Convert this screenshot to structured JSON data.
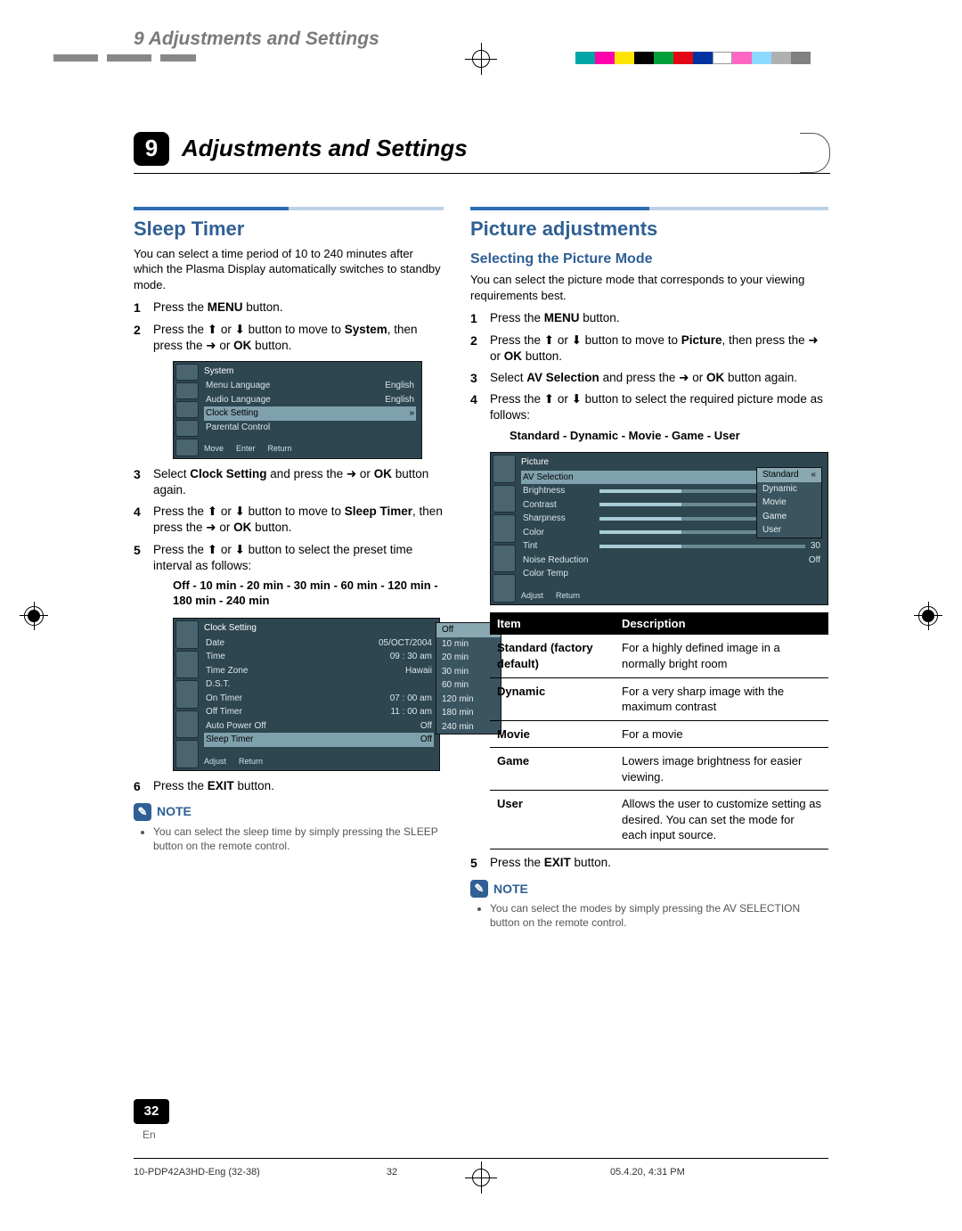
{
  "header": {
    "running": "9 Adjustments and Settings",
    "chapter_num": "9",
    "chapter_title": "Adjustments and Settings"
  },
  "colorbar": [
    "#00a6a6",
    "#ff00aa",
    "#ffe600",
    "#000000",
    "#00a03b",
    "#e30613",
    "#0033a0",
    "#ffffff",
    "#ff66c4",
    "#8cd9ff",
    "#b0b0b0",
    "#808080"
  ],
  "left": {
    "title": "Sleep Timer",
    "intro": "You can select a time period of 10 to 240 minutes after which the Plasma Display automatically switches to standby mode.",
    "steps": {
      "s1_a": "Press the ",
      "s1_b": "MENU",
      "s1_c": " button.",
      "s2_a": "Press the ",
      "s2_b": " or ",
      "s2_c": " button to move to ",
      "s2_d": "System",
      "s2_e": ", then press the ",
      "s2_f": " or ",
      "s2_g": "OK",
      "s2_h": " button.",
      "s3_a": "Select ",
      "s3_b": "Clock Setting",
      "s3_c": " and press the ",
      "s3_d": " or ",
      "s3_e": "OK",
      "s3_f": " button again.",
      "s4_a": "Press the ",
      "s4_b": " or ",
      "s4_c": " button to move to ",
      "s4_d": "Sleep Timer",
      "s4_e": ", then press the ",
      "s4_f": " or ",
      "s4_g": "OK",
      "s4_h": " button.",
      "s5_a": "Press the ",
      "s5_b": " or ",
      "s5_c": " button to select the preset time interval as follows:",
      "s6_a": "Press the ",
      "s6_b": "EXIT",
      "s6_c": " button."
    },
    "timer_options": "Off - 10 min - 20 min - 30 min - 60 min - 120 min - 180 min - 240 min",
    "osd_system": {
      "title": "System",
      "rows": [
        {
          "l": "Menu Language",
          "r": "English"
        },
        {
          "l": "Audio Language",
          "r": "English"
        },
        {
          "l": "Clock Setting",
          "r": "",
          "hl": true
        },
        {
          "l": "Parental Control",
          "r": ""
        }
      ],
      "footer": [
        "Move",
        "Enter",
        "Return"
      ]
    },
    "osd_clock": {
      "title": "Clock Setting",
      "rows": [
        {
          "l": "Date",
          "r": "05/OCT/2004"
        },
        {
          "l": "Time",
          "r": "09 : 30 am"
        },
        {
          "l": "Time Zone",
          "r": "Hawaii"
        },
        {
          "l": "D.S.T.",
          "r": ""
        },
        {
          "l": "On Timer",
          "r": "07 : 00 am"
        },
        {
          "l": "Off Timer",
          "r": "11 : 00 am"
        },
        {
          "l": "Auto Power Off",
          "r": "Off"
        },
        {
          "l": "Sleep Timer",
          "r": "Off",
          "hl": true
        }
      ],
      "footer": [
        "Adjust",
        "Return"
      ],
      "popup": [
        "Off",
        "10 min",
        "20 min",
        "30 min",
        "60 min",
        "120 min",
        "180 min",
        "240 min"
      ]
    },
    "note_title": "NOTE",
    "note_item": "You can select the sleep time by simply pressing the SLEEP button on the remote control."
  },
  "right": {
    "title": "Picture adjustments",
    "sub": "Selecting the Picture Mode",
    "intro": "You can select the picture mode that corresponds to your viewing requirements best.",
    "steps": {
      "s1_a": "Press the ",
      "s1_b": "MENU",
      "s1_c": " button.",
      "s2_a": "Press the ",
      "s2_b": " or ",
      "s2_c": " button to move to ",
      "s2_d": "Picture",
      "s2_e": ", then press the ",
      "s2_f": " or ",
      "s2_g": "OK",
      "s2_h": " button.",
      "s3_a": "Select ",
      "s3_b": "AV Selection",
      "s3_c": " and press the ",
      "s3_d": " or ",
      "s3_e": "OK",
      "s3_f": " button again.",
      "s4_a": "Press the ",
      "s4_b": " or ",
      "s4_c": " button to select the required picture mode as follows:",
      "s5_a": "Press the ",
      "s5_b": "EXIT",
      "s5_c": " button."
    },
    "mode_list": "Standard - Dynamic - Movie - Game - User",
    "osd_picture": {
      "title": "Picture",
      "rows": [
        {
          "l": "AV Selection",
          "r": "Standard",
          "hl": true
        },
        {
          "l": "Brightness",
          "r": "30",
          "slider": true
        },
        {
          "l": "Contrast",
          "r": "30",
          "slider": true
        },
        {
          "l": "Sharpness",
          "r": "30",
          "slider": true
        },
        {
          "l": "Color",
          "r": "30",
          "slider": true
        },
        {
          "l": "Tint",
          "r": "30",
          "slider": true
        },
        {
          "l": "Noise Reduction",
          "r": "Off"
        },
        {
          "l": "Color Temp",
          "r": ""
        }
      ],
      "footer": [
        "Adjust",
        "Return"
      ],
      "popup": [
        "Standard",
        "Dynamic",
        "Movie",
        "Game",
        "User"
      ]
    },
    "table_head": {
      "item": "Item",
      "desc": "Description"
    },
    "table_rows": [
      {
        "k": "Standard (factory default)",
        "v": "For a highly defined image in a normally bright room"
      },
      {
        "k": "Dynamic",
        "v": "For a very sharp image with the maximum contrast"
      },
      {
        "k": "Movie",
        "v": "For a movie"
      },
      {
        "k": "Game",
        "v": "Lowers image brightness for easier viewing."
      },
      {
        "k": "User",
        "v": "Allows the user to customize setting as desired. You can set the mode for each input source."
      }
    ],
    "note_title": "NOTE",
    "note_item": "You can select the modes by simply pressing the AV SELECTION button on the remote control."
  },
  "footer": {
    "pagenum": "32",
    "pagenum_lang": "En",
    "slug_left": "10-PDP42A3HD-Eng (32-38)",
    "slug_center": "32",
    "slug_right": "05.4.20, 4:31 PM"
  },
  "glyphs": {
    "up": "⬆",
    "down": "⬇",
    "right": "➜"
  }
}
